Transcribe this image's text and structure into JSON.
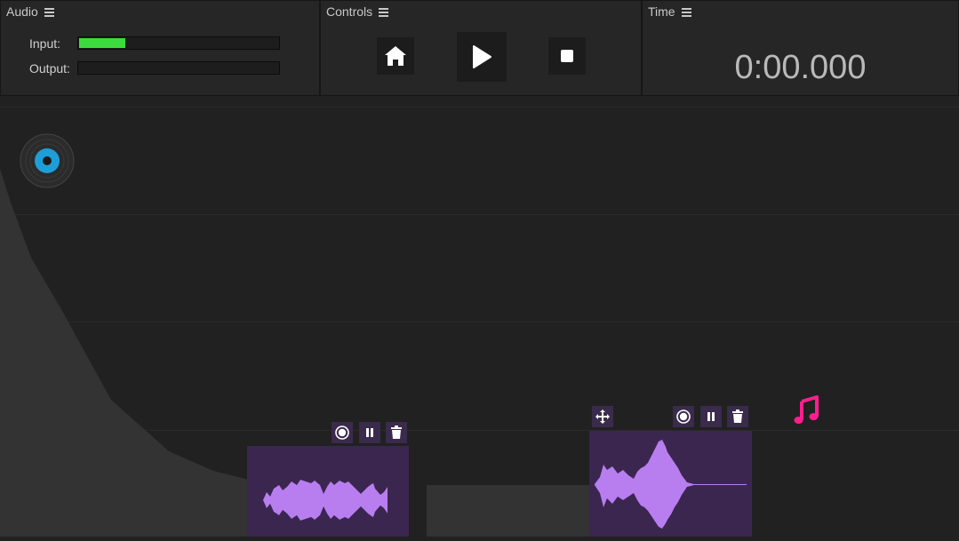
{
  "audio": {
    "title": "Audio",
    "input_label": "Input:",
    "output_label": "Output:",
    "input_level": 0.23,
    "output_level": 0.0
  },
  "controls": {
    "title": "Controls",
    "buttons": [
      "home-icon",
      "play-icon",
      "stop-icon"
    ]
  },
  "time": {
    "title": "Time",
    "value": "0:00.000"
  },
  "colors": {
    "accent_green": "#3ddc3d",
    "waveform": "#b87ef0",
    "clip_bg": "#3b2650",
    "note_icon": "#ff1f8e",
    "disc_blue": "#1e9ed8"
  },
  "clips": [
    {
      "name": "clip-1",
      "icons": [
        "record-icon",
        "pause-icon",
        "trash-icon"
      ]
    },
    {
      "name": "clip-2",
      "icons": [
        "move-icon",
        "record-icon",
        "pause-icon",
        "trash-icon"
      ]
    }
  ],
  "floating_icons": [
    "vinyl-disc-icon",
    "music-note-icon"
  ]
}
